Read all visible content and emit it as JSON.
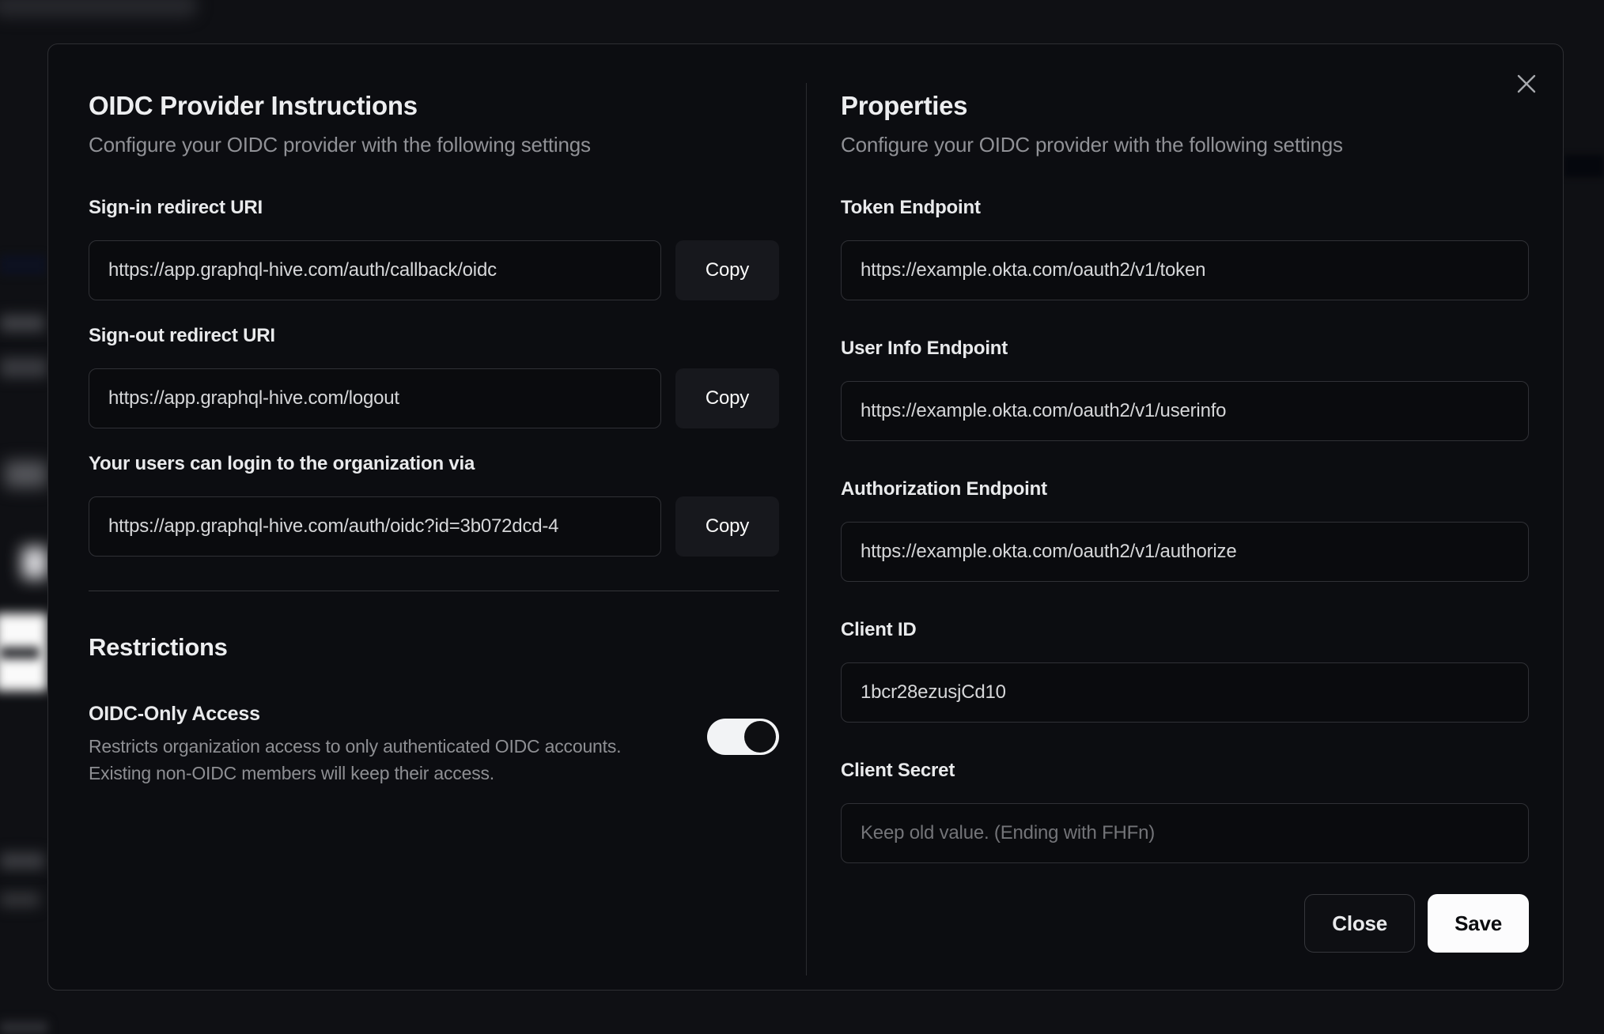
{
  "modal": {
    "close_icon": "x-cross",
    "left": {
      "title": "OIDC Provider Instructions",
      "subtitle": "Configure your OIDC provider with the following settings",
      "fields": [
        {
          "label": "Sign-in redirect URI",
          "value": "https://app.graphql-hive.com/auth/callback/oidc",
          "copy_label": "Copy"
        },
        {
          "label": "Sign-out redirect URI",
          "value": "https://app.graphql-hive.com/logout",
          "copy_label": "Copy"
        },
        {
          "label": "Your users can login to the organization via",
          "value": "https://app.graphql-hive.com/auth/oidc?id=3b072dcd-4",
          "copy_label": "Copy"
        }
      ],
      "restrictions": {
        "title": "Restrictions",
        "toggle_label": "OIDC-Only Access",
        "toggle_description": "Restricts organization access to only authenticated OIDC accounts. Existing non-OIDC members will keep their access.",
        "toggle_state": "on"
      }
    },
    "right": {
      "title": "Properties",
      "subtitle": "Configure your OIDC provider with the following settings",
      "fields": [
        {
          "label": "Token Endpoint",
          "value": "https://example.okta.com/oauth2/v1/token"
        },
        {
          "label": "User Info Endpoint",
          "value": "https://example.okta.com/oauth2/v1/userinfo"
        },
        {
          "label": "Authorization Endpoint",
          "value": "https://example.okta.com/oauth2/v1/authorize"
        },
        {
          "label": "Client ID",
          "value": "1bcr28ezusjCd10"
        },
        {
          "label": "Client Secret",
          "value": "",
          "placeholder": "Keep old value. (Ending with FHFn)"
        }
      ],
      "buttons": {
        "close": "Close",
        "save": "Save"
      }
    }
  },
  "colors": {
    "modal_background": "#0c0d11",
    "modal_border": "#2e2f33",
    "input_border": "#303136",
    "copy_button_background": "#17181d",
    "save_button_background": "#fcfcfd",
    "toggle_on_track": "#f2f3f5",
    "heading_text": "#edeef0",
    "muted_text": "#909196"
  }
}
